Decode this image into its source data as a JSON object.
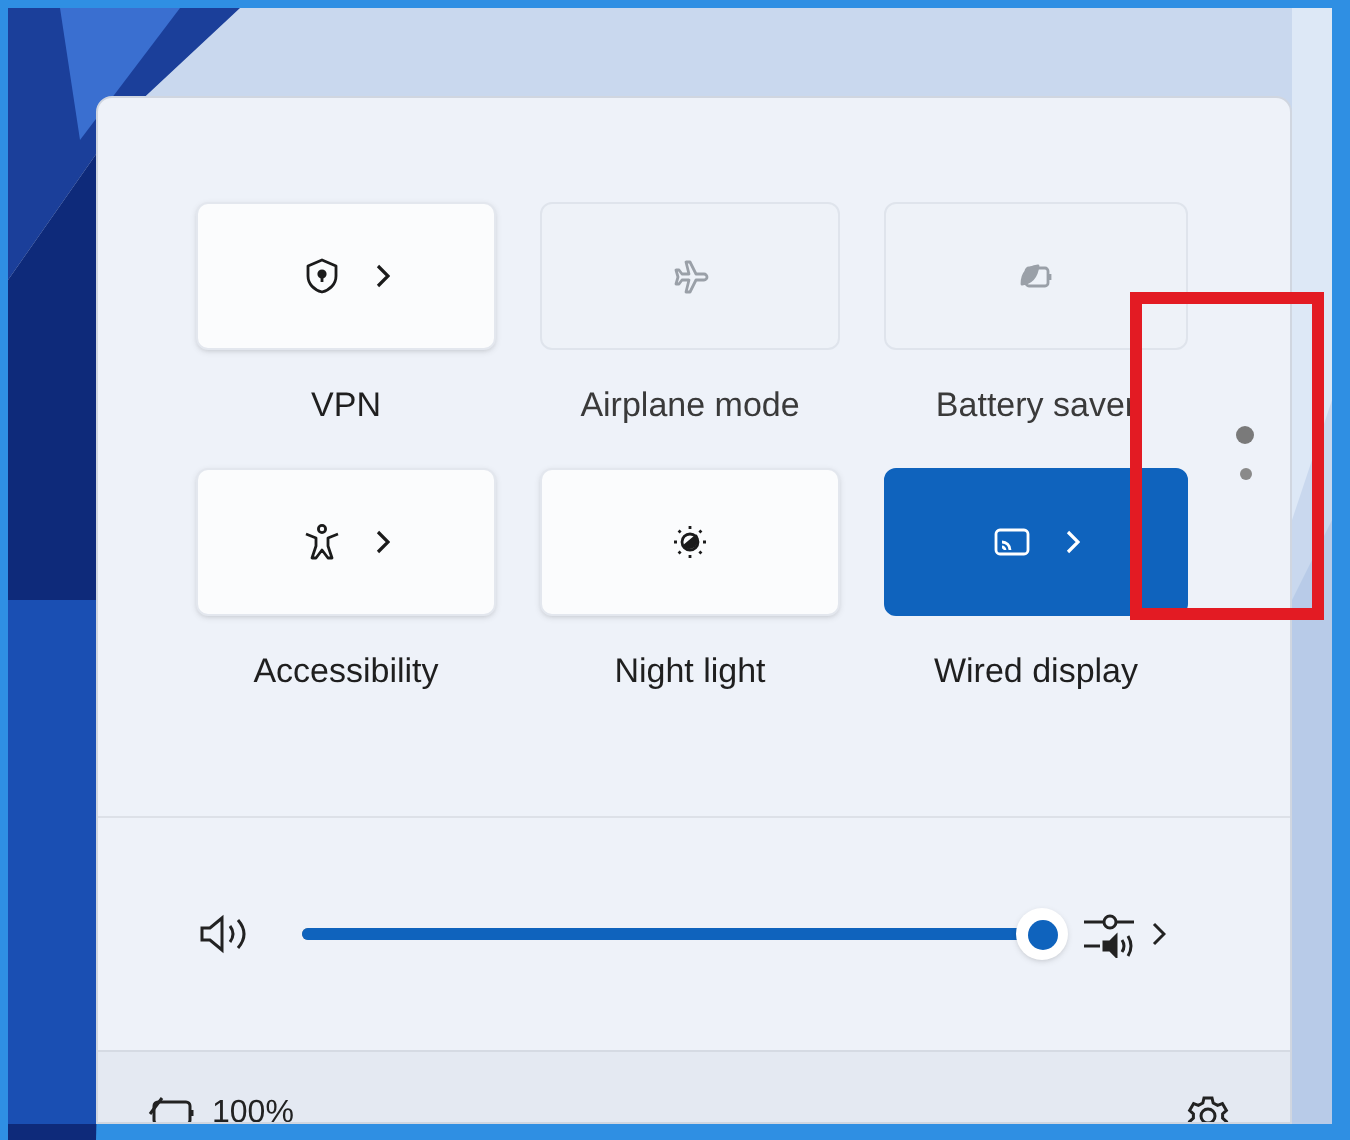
{
  "tiles": [
    {
      "label": "VPN",
      "kind": "shield",
      "on": false,
      "disabled": false,
      "chevron": true
    },
    {
      "label": "Airplane mode",
      "kind": "airplane",
      "on": false,
      "disabled": true,
      "chevron": false
    },
    {
      "label": "Battery saver",
      "kind": "battery-saver",
      "on": false,
      "disabled": true,
      "chevron": false
    },
    {
      "label": "Accessibility",
      "kind": "person",
      "on": false,
      "disabled": false,
      "chevron": true
    },
    {
      "label": "Night light",
      "kind": "night",
      "on": false,
      "disabled": false,
      "chevron": false
    },
    {
      "label": "Wired display",
      "kind": "cast",
      "on": true,
      "disabled": false,
      "chevron": true
    }
  ],
  "pages": [
    {
      "selected": true
    },
    {
      "selected": false
    }
  ],
  "volume": {
    "level": 1
  },
  "battery": {
    "reading": "100%"
  }
}
